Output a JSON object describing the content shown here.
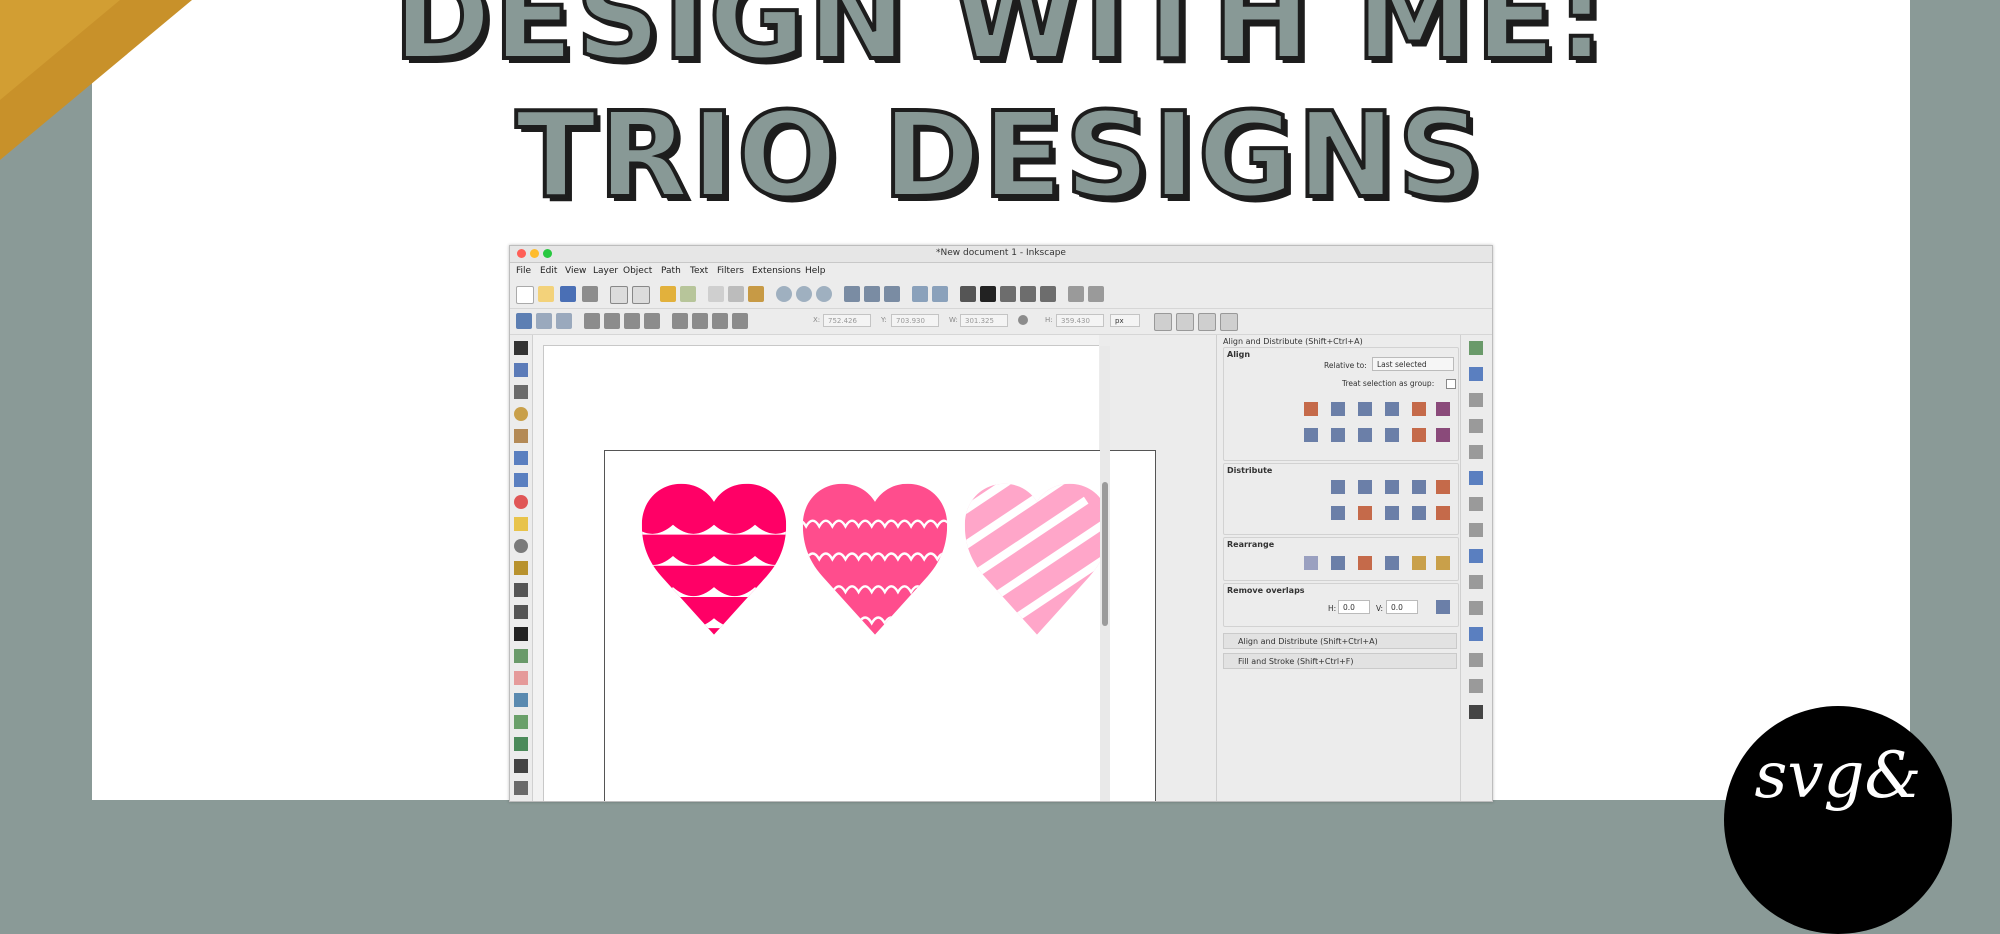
{
  "banner": {
    "line1": "DESIGN WITH ME:",
    "line2": "TRIO DESIGNS",
    "colors": {
      "title_fill": "#889996",
      "title_outline": "#1d1d1d",
      "background": "#8a9a97",
      "panel": "#ffffff",
      "corner": "#c8912a"
    }
  },
  "logo": {
    "text": "svg&"
  },
  "window": {
    "title": "*New document 1 - Inkscape",
    "menu": [
      "File",
      "Edit",
      "View",
      "Layer",
      "Object",
      "Path",
      "Text",
      "Filters",
      "Extensions",
      "Help"
    ],
    "command_icons": [
      "new-icon",
      "open-icon",
      "save-icon",
      "print-icon",
      "import-icon",
      "export-icon",
      "undo-icon",
      "redo-icon",
      "copy-icon",
      "cut-icon",
      "paste-icon",
      "zoom-selection-icon",
      "zoom-drawing-icon",
      "zoom-page-icon",
      "duplicate-icon",
      "clone-icon",
      "unlink-clone-icon",
      "group-icon",
      "ungroup-icon",
      "xml-editor-icon",
      "text-icon",
      "layers-icon",
      "export-bitmap-icon",
      "align-icon",
      "preferences-icon",
      "document-properties-icon"
    ],
    "controls": {
      "x_label": "X:",
      "x_value": "752.426",
      "y_label": "Y:",
      "y_value": "703.930",
      "w_label": "W:",
      "w_value": "301.325",
      "h_label": "H:",
      "h_value": "359.430",
      "unit": "px"
    },
    "hearts": [
      {
        "name": "scallop-heart",
        "color": "#ff0066"
      },
      {
        "name": "loop-heart",
        "color": "#ff4d8d"
      },
      {
        "name": "stripe-heart",
        "color": "#ffa6c9"
      }
    ],
    "dock": {
      "title": "Align and Distribute (Shift+Ctrl+A)",
      "align_label": "Align",
      "relative_label": "Relative to:",
      "relative_value": "Last selected",
      "treat_group_label": "Treat selection as group:",
      "distribute_label": "Distribute",
      "rearrange_label": "Rearrange",
      "remove_overlaps_label": "Remove overlaps",
      "h_label": "H:",
      "h_value": "0.0",
      "v_label": "V:",
      "v_value": "0.0",
      "panel1": "Align and Distribute (Shift+Ctrl+A)",
      "panel2": "Fill and Stroke (Shift+Ctrl+F)"
    }
  }
}
